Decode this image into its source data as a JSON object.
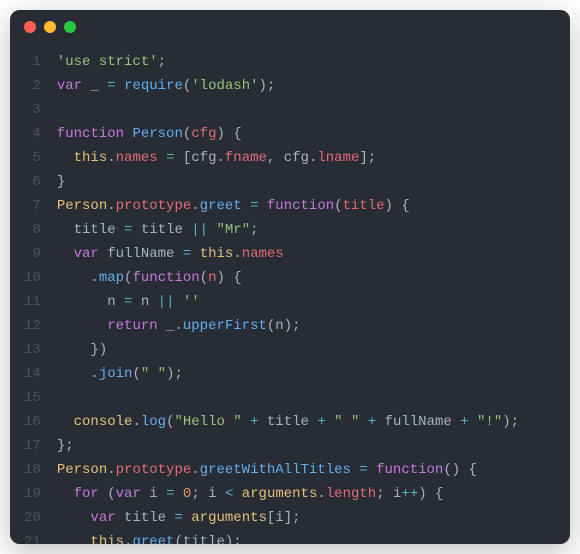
{
  "window": {
    "traffic_light_titles": {
      "red": "close",
      "yellow": "minimize",
      "green": "zoom"
    }
  },
  "gutter": {
    "start": 1,
    "end": 21
  },
  "code_lines": [
    [
      {
        "c": "str",
        "t": "'use strict'"
      },
      {
        "c": "pn",
        "t": ";"
      }
    ],
    [
      {
        "c": "kw",
        "t": "var"
      },
      {
        "c": "pn",
        "t": " "
      },
      {
        "c": "ident",
        "t": "_"
      },
      {
        "c": "pn",
        "t": " "
      },
      {
        "c": "op",
        "t": "="
      },
      {
        "c": "pn",
        "t": " "
      },
      {
        "c": "fn",
        "t": "require"
      },
      {
        "c": "pn",
        "t": "("
      },
      {
        "c": "str",
        "t": "'lodash'"
      },
      {
        "c": "pn",
        "t": ");"
      }
    ],
    [],
    [
      {
        "c": "kw",
        "t": "function"
      },
      {
        "c": "pn",
        "t": " "
      },
      {
        "c": "fn",
        "t": "Person"
      },
      {
        "c": "pn",
        "t": "("
      },
      {
        "c": "param",
        "t": "cfg"
      },
      {
        "c": "pn",
        "t": ") {"
      }
    ],
    [
      {
        "c": "pn",
        "t": "  "
      },
      {
        "c": "this",
        "t": "this"
      },
      {
        "c": "pn",
        "t": "."
      },
      {
        "c": "prop",
        "t": "names"
      },
      {
        "c": "pn",
        "t": " "
      },
      {
        "c": "op",
        "t": "="
      },
      {
        "c": "pn",
        "t": " ["
      },
      {
        "c": "ident",
        "t": "cfg"
      },
      {
        "c": "pn",
        "t": "."
      },
      {
        "c": "prop",
        "t": "fname"
      },
      {
        "c": "pn",
        "t": ", "
      },
      {
        "c": "ident",
        "t": "cfg"
      },
      {
        "c": "pn",
        "t": "."
      },
      {
        "c": "prop",
        "t": "lname"
      },
      {
        "c": "pn",
        "t": "];"
      }
    ],
    [
      {
        "c": "pn",
        "t": "}"
      }
    ],
    [
      {
        "c": "const",
        "t": "Person"
      },
      {
        "c": "pn",
        "t": "."
      },
      {
        "c": "prop",
        "t": "prototype"
      },
      {
        "c": "pn",
        "t": "."
      },
      {
        "c": "fn",
        "t": "greet"
      },
      {
        "c": "pn",
        "t": " "
      },
      {
        "c": "op",
        "t": "="
      },
      {
        "c": "pn",
        "t": " "
      },
      {
        "c": "kw",
        "t": "function"
      },
      {
        "c": "pn",
        "t": "("
      },
      {
        "c": "param",
        "t": "title"
      },
      {
        "c": "pn",
        "t": ") {"
      }
    ],
    [
      {
        "c": "pn",
        "t": "  "
      },
      {
        "c": "ident",
        "t": "title"
      },
      {
        "c": "pn",
        "t": " "
      },
      {
        "c": "op",
        "t": "="
      },
      {
        "c": "pn",
        "t": " "
      },
      {
        "c": "ident",
        "t": "title"
      },
      {
        "c": "pn",
        "t": " "
      },
      {
        "c": "op",
        "t": "||"
      },
      {
        "c": "pn",
        "t": " "
      },
      {
        "c": "str",
        "t": "\"Mr\""
      },
      {
        "c": "pn",
        "t": ";"
      }
    ],
    [
      {
        "c": "pn",
        "t": "  "
      },
      {
        "c": "kw",
        "t": "var"
      },
      {
        "c": "pn",
        "t": " "
      },
      {
        "c": "ident",
        "t": "fullName"
      },
      {
        "c": "pn",
        "t": " "
      },
      {
        "c": "op",
        "t": "="
      },
      {
        "c": "pn",
        "t": " "
      },
      {
        "c": "this",
        "t": "this"
      },
      {
        "c": "pn",
        "t": "."
      },
      {
        "c": "prop",
        "t": "names"
      }
    ],
    [
      {
        "c": "pn",
        "t": "    ."
      },
      {
        "c": "fn",
        "t": "map"
      },
      {
        "c": "pn",
        "t": "("
      },
      {
        "c": "kw",
        "t": "function"
      },
      {
        "c": "pn",
        "t": "("
      },
      {
        "c": "param",
        "t": "n"
      },
      {
        "c": "pn",
        "t": ") {"
      }
    ],
    [
      {
        "c": "pn",
        "t": "      "
      },
      {
        "c": "ident",
        "t": "n"
      },
      {
        "c": "pn",
        "t": " "
      },
      {
        "c": "op",
        "t": "="
      },
      {
        "c": "pn",
        "t": " "
      },
      {
        "c": "ident",
        "t": "n"
      },
      {
        "c": "pn",
        "t": " "
      },
      {
        "c": "op",
        "t": "||"
      },
      {
        "c": "pn",
        "t": " "
      },
      {
        "c": "str",
        "t": "''"
      }
    ],
    [
      {
        "c": "pn",
        "t": "      "
      },
      {
        "c": "kw",
        "t": "return"
      },
      {
        "c": "pn",
        "t": " "
      },
      {
        "c": "ident",
        "t": "_"
      },
      {
        "c": "pn",
        "t": "."
      },
      {
        "c": "fn",
        "t": "upperFirst"
      },
      {
        "c": "pn",
        "t": "("
      },
      {
        "c": "ident",
        "t": "n"
      },
      {
        "c": "pn",
        "t": ");"
      }
    ],
    [
      {
        "c": "pn",
        "t": "    })"
      }
    ],
    [
      {
        "c": "pn",
        "t": "    ."
      },
      {
        "c": "fn",
        "t": "join"
      },
      {
        "c": "pn",
        "t": "("
      },
      {
        "c": "str",
        "t": "\" \""
      },
      {
        "c": "pn",
        "t": ");"
      }
    ],
    [],
    [
      {
        "c": "pn",
        "t": "  "
      },
      {
        "c": "const",
        "t": "console"
      },
      {
        "c": "pn",
        "t": "."
      },
      {
        "c": "fn",
        "t": "log"
      },
      {
        "c": "pn",
        "t": "("
      },
      {
        "c": "str",
        "t": "\"Hello \""
      },
      {
        "c": "pn",
        "t": " "
      },
      {
        "c": "op",
        "t": "+"
      },
      {
        "c": "pn",
        "t": " "
      },
      {
        "c": "ident",
        "t": "title"
      },
      {
        "c": "pn",
        "t": " "
      },
      {
        "c": "op",
        "t": "+"
      },
      {
        "c": "pn",
        "t": " "
      },
      {
        "c": "str",
        "t": "\" \""
      },
      {
        "c": "pn",
        "t": " "
      },
      {
        "c": "op",
        "t": "+"
      },
      {
        "c": "pn",
        "t": " "
      },
      {
        "c": "ident",
        "t": "fullName"
      },
      {
        "c": "pn",
        "t": " "
      },
      {
        "c": "op",
        "t": "+"
      },
      {
        "c": "pn",
        "t": " "
      },
      {
        "c": "str",
        "t": "\"!\""
      },
      {
        "c": "pn",
        "t": ");"
      }
    ],
    [
      {
        "c": "pn",
        "t": "};"
      }
    ],
    [
      {
        "c": "const",
        "t": "Person"
      },
      {
        "c": "pn",
        "t": "."
      },
      {
        "c": "prop",
        "t": "prototype"
      },
      {
        "c": "pn",
        "t": "."
      },
      {
        "c": "fn",
        "t": "greetWithAllTitles"
      },
      {
        "c": "pn",
        "t": " "
      },
      {
        "c": "op",
        "t": "="
      },
      {
        "c": "pn",
        "t": " "
      },
      {
        "c": "kw",
        "t": "function"
      },
      {
        "c": "pn",
        "t": "() {"
      }
    ],
    [
      {
        "c": "pn",
        "t": "  "
      },
      {
        "c": "kw",
        "t": "for"
      },
      {
        "c": "pn",
        "t": " ("
      },
      {
        "c": "kw",
        "t": "var"
      },
      {
        "c": "pn",
        "t": " "
      },
      {
        "c": "ident",
        "t": "i"
      },
      {
        "c": "pn",
        "t": " "
      },
      {
        "c": "op",
        "t": "="
      },
      {
        "c": "pn",
        "t": " "
      },
      {
        "c": "num",
        "t": "0"
      },
      {
        "c": "pn",
        "t": "; "
      },
      {
        "c": "ident",
        "t": "i"
      },
      {
        "c": "pn",
        "t": " "
      },
      {
        "c": "op",
        "t": "<"
      },
      {
        "c": "pn",
        "t": " "
      },
      {
        "c": "this",
        "t": "arguments"
      },
      {
        "c": "pn",
        "t": "."
      },
      {
        "c": "prop",
        "t": "length"
      },
      {
        "c": "pn",
        "t": "; "
      },
      {
        "c": "ident",
        "t": "i"
      },
      {
        "c": "op",
        "t": "++"
      },
      {
        "c": "pn",
        "t": ") {"
      }
    ],
    [
      {
        "c": "pn",
        "t": "    "
      },
      {
        "c": "kw",
        "t": "var"
      },
      {
        "c": "pn",
        "t": " "
      },
      {
        "c": "ident",
        "t": "title"
      },
      {
        "c": "pn",
        "t": " "
      },
      {
        "c": "op",
        "t": "="
      },
      {
        "c": "pn",
        "t": " "
      },
      {
        "c": "this",
        "t": "arguments"
      },
      {
        "c": "pn",
        "t": "["
      },
      {
        "c": "ident",
        "t": "i"
      },
      {
        "c": "pn",
        "t": "];"
      }
    ],
    [
      {
        "c": "pn",
        "t": "    "
      },
      {
        "c": "this",
        "t": "this"
      },
      {
        "c": "pn",
        "t": "."
      },
      {
        "c": "fn",
        "t": "greet"
      },
      {
        "c": "pn",
        "t": "("
      },
      {
        "c": "ident",
        "t": "title"
      },
      {
        "c": "pn",
        "t": ");"
      }
    ]
  ]
}
